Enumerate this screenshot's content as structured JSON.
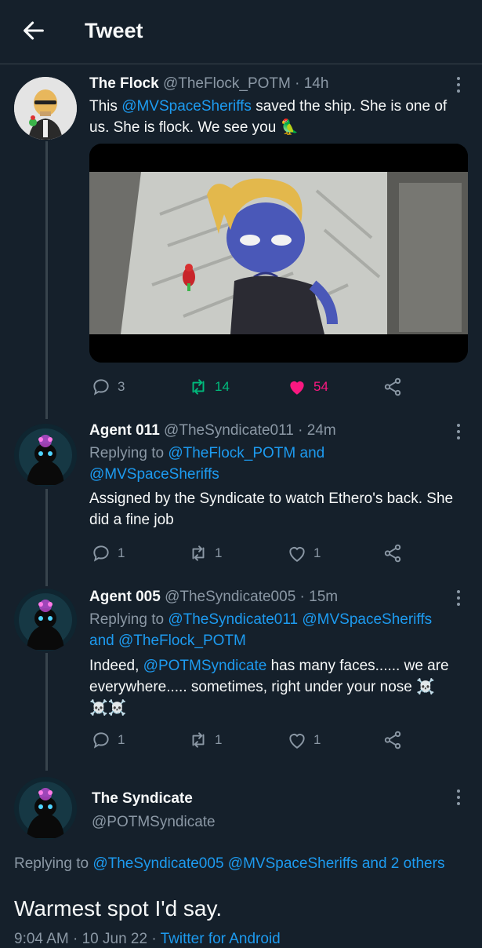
{
  "header": {
    "title": "Tweet"
  },
  "tweets": [
    {
      "name": "The Flock",
      "handle": "@TheFlock_POTM",
      "time": "· 14h",
      "text_pre": "This ",
      "text_mention": "@MVSpaceSheriffs",
      "text_post": " saved the ship. She is one of us. She is flock. We see you 🦜",
      "replies": "3",
      "retweets": "14",
      "likes": "54",
      "liked": true,
      "retweeted": true
    },
    {
      "name": "Agent 011",
      "handle": "@TheSyndicate011",
      "time": "· 24m",
      "replying_label": "Replying to",
      "replying_1": "@TheFlock_POTM",
      "replying_and": "and",
      "replying_2": "@MVSpaceSheriffs",
      "text": "Assigned by the Syndicate to watch Ethero's back. She did a fine job",
      "replies": "1",
      "retweets": "1",
      "likes": "1"
    },
    {
      "name": "Agent 005",
      "handle": "@TheSyndicate005",
      "time": "· 15m",
      "replying_label": "Replying to",
      "replying_1": "@TheSyndicate011",
      "replying_2": "@MVSpaceSheriffs",
      "replying_and": "and",
      "replying_3": "@TheFlock_POTM",
      "text_pre": "Indeed, ",
      "text_mention": "@POTMSyndicate",
      "text_post": " has many faces...... we are everywhere..... sometimes, right under your nose ☠️ ☠️☠️",
      "replies": "1",
      "retweets": "1",
      "likes": "1"
    }
  ],
  "main_tweet": {
    "name": "The Syndicate",
    "handle": "@POTMSyndicate",
    "replying_label": "Replying to",
    "replying_1": "@TheSyndicate005",
    "replying_2": "@MVSpaceSheriffs",
    "replying_and": "and",
    "replying_others": "2 others",
    "text": "Warmest spot I'd say.",
    "meta_time": "9:04 AM · 10 Jun 22 · ",
    "meta_source": "Twitter for Android"
  },
  "colors": {
    "background": "#15202b",
    "link": "#1d9bf0",
    "like": "#f91880",
    "retweet": "#00ba7c",
    "muted": "#8b98a5"
  }
}
